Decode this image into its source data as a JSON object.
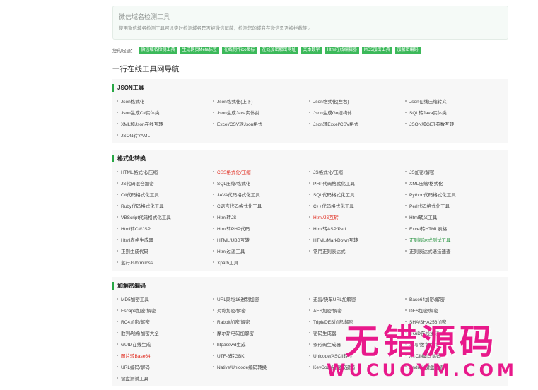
{
  "intro": {
    "title": "微信域名检测工具",
    "desc": "使用微信域名检测工具可以实时检测域名是否被微信屏蔽，检测您的域名在微信是否被拦截等 。"
  },
  "recent": {
    "label": "您的足迹：",
    "chips": [
      "微信域名检测工具",
      "生成网页Meta标签",
      "在线制作ico图标",
      "在线加密解密网址",
      "文本数字",
      "Html在线编辑器",
      "MD5加密工具",
      "加解密编码"
    ]
  },
  "nav_heading": "一行在线工具网导航",
  "sections": [
    {
      "title": "JSON工具",
      "items": [
        {
          "label": "Json格式化"
        },
        {
          "label": "Json格式化(上下)"
        },
        {
          "label": "Json格式化(左右)"
        },
        {
          "label": "Json在线压缩转义"
        },
        {
          "label": "Json生成C#实体类"
        },
        {
          "label": "Json生成Java实体类"
        },
        {
          "label": "Json生成Go结构体"
        },
        {
          "label": "SQL转Java实体类"
        },
        {
          "label": "XML和Json在线互转"
        },
        {
          "label": "Excel/CSV转Json格式"
        },
        {
          "label": "Json转Excel/CSV格式"
        },
        {
          "label": "JSON和GET参数互转"
        },
        {
          "label": "JSON转YAML"
        }
      ]
    },
    {
      "title": "格式化转换",
      "items": [
        {
          "label": "HTML格式化/压缩"
        },
        {
          "label": "CSS格式化/压缩",
          "color": "red"
        },
        {
          "label": "JS格式化/压缩"
        },
        {
          "label": "JS加密/解密"
        },
        {
          "label": "JS代码混合加密"
        },
        {
          "label": "SQL压缩/格式化"
        },
        {
          "label": "PHP代码格式化工具"
        },
        {
          "label": "XML压缩/格式化"
        },
        {
          "label": "C#代码格式化工具"
        },
        {
          "label": "JAVA代码格式化工具"
        },
        {
          "label": "SQL代码格式化工具"
        },
        {
          "label": "Python代码格式化工具"
        },
        {
          "label": "Ruby代码格式化工具"
        },
        {
          "label": "C语言代码格式化工具"
        },
        {
          "label": "C++代码格式化工具"
        },
        {
          "label": "Perl代码格式化工具"
        },
        {
          "label": "VBScript代码格式化工具"
        },
        {
          "label": "Html转JS"
        },
        {
          "label": "Html/JS互转",
          "color": "red"
        },
        {
          "label": "Html转义工具"
        },
        {
          "label": "Html转C#/JSP"
        },
        {
          "label": "Html转PHP代码"
        },
        {
          "label": "Html转ASP/Perl"
        },
        {
          "label": "Excel转HTML表格"
        },
        {
          "label": "Html表格生成器"
        },
        {
          "label": "HTML/UBB互转"
        },
        {
          "label": "HTML/MarkDown互转"
        },
        {
          "label": "正则表达式测试工具",
          "color": "green"
        },
        {
          "label": "正则生成代码"
        },
        {
          "label": "Html过滤工具"
        },
        {
          "label": "常用正则表达式"
        },
        {
          "label": "正则表达式语法速查"
        },
        {
          "label": "蓝行Js/html/css"
        },
        {
          "label": "Xpath工具"
        }
      ]
    },
    {
      "title": "加解密编码",
      "items": [
        {
          "label": "MD5加密工具"
        },
        {
          "label": "URL网址16进制加密"
        },
        {
          "label": "迅雷/快车URL加解密"
        },
        {
          "label": "Base64加密/解密"
        },
        {
          "label": "Escape加密/解密"
        },
        {
          "label": "对称加密/解密"
        },
        {
          "label": "AES加密/解密"
        },
        {
          "label": "DES加密/解密"
        },
        {
          "label": "RC4加密/解密"
        },
        {
          "label": "Rabbit加密/解密"
        },
        {
          "label": "TripleDES加密/解密"
        },
        {
          "label": "SHA/SHA256加密"
        },
        {
          "label": "散列/哈希加密大全"
        },
        {
          "label": "摩尔斯电码加解密"
        },
        {
          "label": "密码生成器"
        },
        {
          "label": "UUID在线生成"
        },
        {
          "label": "GUID在线生成"
        },
        {
          "label": "htpasswd生成"
        },
        {
          "label": "条形码生成器"
        },
        {
          "label": "小写/数字互转"
        },
        {
          "label": "图片转Base64",
          "color": "red"
        },
        {
          "label": "UTF-8转GBK"
        },
        {
          "label": "Unicode/ASCII转换"
        },
        {
          "label": "ASCII编码/解码"
        },
        {
          "label": "URL编码/解码"
        },
        {
          "label": "Native/Unicode编码转换"
        },
        {
          "label": "KeyCode键盘按键码"
        },
        {
          "label": "Android键盘键值"
        },
        {
          "label": "键盘测试工具"
        }
      ]
    }
  ],
  "watermark": {
    "big": "无错源码",
    "small": "WUCUOYM.COM"
  },
  "colors": {
    "accent_green": "#3cb95a",
    "section_bar": "#28a745",
    "link_red": "#e0281b",
    "link_green": "#1e8f38",
    "watermark": "#e8198b"
  }
}
